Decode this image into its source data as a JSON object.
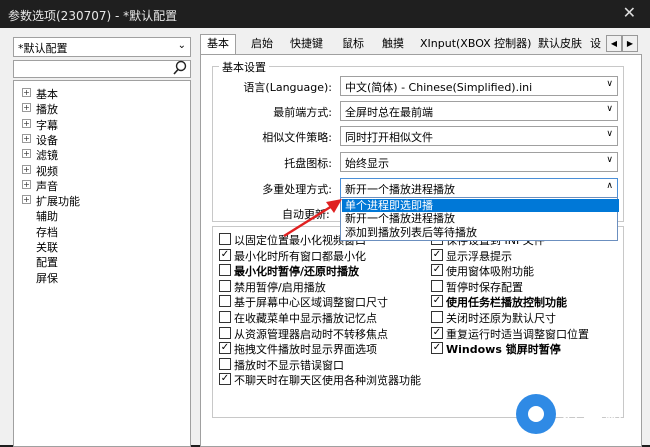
{
  "window": {
    "title": "参数选项(230707) - *默认配置",
    "close_glyph": "✕"
  },
  "left": {
    "profile": "*默认配置",
    "tree": [
      "基本",
      "播放",
      "字幕",
      "设备",
      "滤镜",
      "视频",
      "声音",
      "扩展功能",
      "辅助",
      "存档",
      "关联",
      "配置",
      "屏保"
    ]
  },
  "tabs": [
    "基本",
    "启始",
    "快捷键",
    "鼠标",
    "触摸",
    "XInput(XBOX 控制器)",
    "默认皮肤",
    "设"
  ],
  "basic": {
    "group_title": "基本设置",
    "rows": [
      {
        "label": "语言(Language):",
        "value": "中文(简体) - Chinese(Simplified).ini"
      },
      {
        "label": "最前端方式:",
        "value": "全屏时总在最前端"
      },
      {
        "label": "相似文件策略:",
        "value": "同时打开相似文件"
      },
      {
        "label": "托盘图标:",
        "value": "始终显示"
      },
      {
        "label": "多重处理方式:",
        "value": "新开一个播放进程播放"
      }
    ],
    "auto_label": "自动更新:",
    "dropdown": [
      "单个进程即选即播",
      "新开一个播放进程播放",
      "添加到播放列表后等待播放"
    ]
  },
  "options_left": [
    {
      "label": "以固定位置最小化视频窗口",
      "checked": false,
      "bold": false
    },
    {
      "label": "最小化时所有窗口都最小化",
      "checked": true,
      "bold": false
    },
    {
      "label": "最小化时暂停/还原时播放",
      "checked": false,
      "bold": true
    },
    {
      "label": "禁用暂停/启用播放",
      "checked": false,
      "bold": false
    },
    {
      "label": "基于屏幕中心区域调整窗口尺寸",
      "checked": false,
      "bold": false
    },
    {
      "label": "在收藏菜单中显示播放记忆点",
      "checked": false,
      "bold": false
    },
    {
      "label": "从资源管理器启动时不转移焦点",
      "checked": false,
      "bold": false
    },
    {
      "label": "拖拽文件播放时显示界面选项",
      "checked": true,
      "bold": false
    },
    {
      "label": "播放时不显示错误窗口",
      "checked": false,
      "bold": false
    },
    {
      "label": "不聊天时在聊天区使用各种浏览器功能",
      "checked": true,
      "bold": false
    }
  ],
  "options_right": [
    {
      "label": "保存设置到 INI 文件",
      "checked": false,
      "bold": false
    },
    {
      "label": "显示浮悬提示",
      "checked": true,
      "bold": false
    },
    {
      "label": "使用窗体吸附功能",
      "checked": true,
      "bold": false
    },
    {
      "label": "暂停时保存配置",
      "checked": false,
      "bold": false
    },
    {
      "label": "使用任务栏播放控制功能",
      "checked": true,
      "bold": true
    },
    {
      "label": "关闭时还原为默认尺寸",
      "checked": false,
      "bold": false
    },
    {
      "label": "重复运行时适当调整窗口位置",
      "checked": true,
      "bold": false
    },
    {
      "label": "Windows 锁屏时暂停",
      "checked": true,
      "bold": true
    }
  ],
  "watermark": {
    "text": "好装机"
  }
}
